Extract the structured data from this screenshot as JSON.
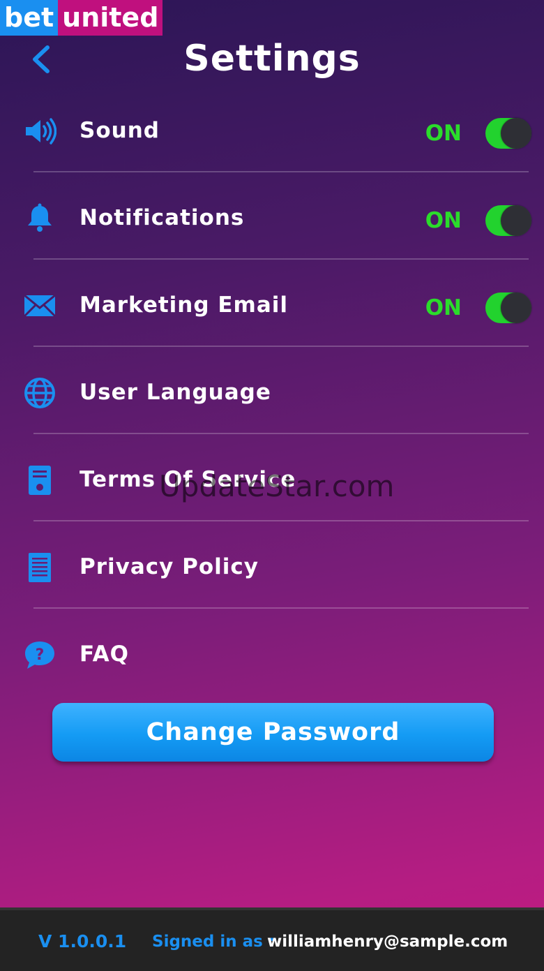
{
  "brand": {
    "part1": "bet",
    "part2": "united"
  },
  "header": {
    "title": "Settings",
    "back_icon": "chevron-left-icon"
  },
  "settings": [
    {
      "label": "Sound",
      "icon": "speaker-icon",
      "state": "ON",
      "toggle": true
    },
    {
      "label": "Notifications",
      "icon": "bell-icon",
      "state": "ON",
      "toggle": true
    },
    {
      "label": "Marketing Email",
      "icon": "envelope-icon",
      "state": "ON",
      "toggle": true
    },
    {
      "label": "User Language",
      "icon": "globe-icon"
    },
    {
      "label": "Terms Of Service",
      "icon": "document-icon"
    },
    {
      "label": "Privacy Policy",
      "icon": "list-document-icon"
    },
    {
      "label": "FAQ",
      "icon": "question-bubble-icon"
    }
  ],
  "actions": {
    "change_password": "Change Password"
  },
  "watermark": "UpdateStar.com",
  "footer": {
    "version": "V 1.0.0.1",
    "signed_in_label": "Signed in as :",
    "email": "williamhenry@sample.com"
  },
  "colors": {
    "accent": "#1a8ff0",
    "on_green": "#2bdc2b",
    "brand_pink": "#c0107e"
  }
}
